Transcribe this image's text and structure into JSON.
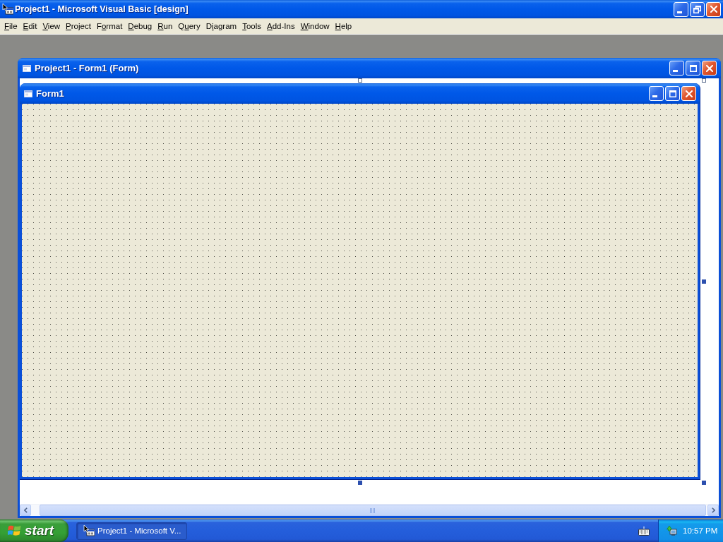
{
  "window": {
    "title": "Project1 - Microsoft Visual Basic [design]",
    "buttons": [
      {
        "kind": "minimize"
      },
      {
        "kind": "restore"
      },
      {
        "kind": "close"
      }
    ]
  },
  "menu_bar": [
    {
      "key": "F",
      "after": "ile"
    },
    {
      "key": "E",
      "after": "dit"
    },
    {
      "key": "V",
      "after": "iew"
    },
    {
      "key": "P",
      "after": "roject"
    },
    {
      "before": "F",
      "key": "o",
      "after": "rmat"
    },
    {
      "key": "D",
      "after": "ebug"
    },
    {
      "key": "R",
      "after": "un"
    },
    {
      "before": "Q",
      "key": "u",
      "after": "ery"
    },
    {
      "before": "D",
      "key": "i",
      "after": "agram"
    },
    {
      "key": "T",
      "after": "ools"
    },
    {
      "key": "A",
      "after": "dd-Ins"
    },
    {
      "key": "W",
      "after": "indow"
    },
    {
      "key": "H",
      "after": "elp"
    }
  ],
  "designer": {
    "title": "Project1 - Form1 (Form)",
    "buttons": [
      {
        "kind": "minimize"
      },
      {
        "kind": "maximize"
      },
      {
        "kind": "close"
      }
    ],
    "form": {
      "title": "Form1",
      "buttons": [
        {
          "kind": "minimize"
        },
        {
          "kind": "maximize"
        },
        {
          "kind": "close"
        }
      ],
      "grid": true
    }
  },
  "taskbar": {
    "start": "start",
    "tasks": [
      {
        "label": "Project1 - Microsoft V...",
        "selected": true
      }
    ],
    "clock": "10:57 PM"
  }
}
